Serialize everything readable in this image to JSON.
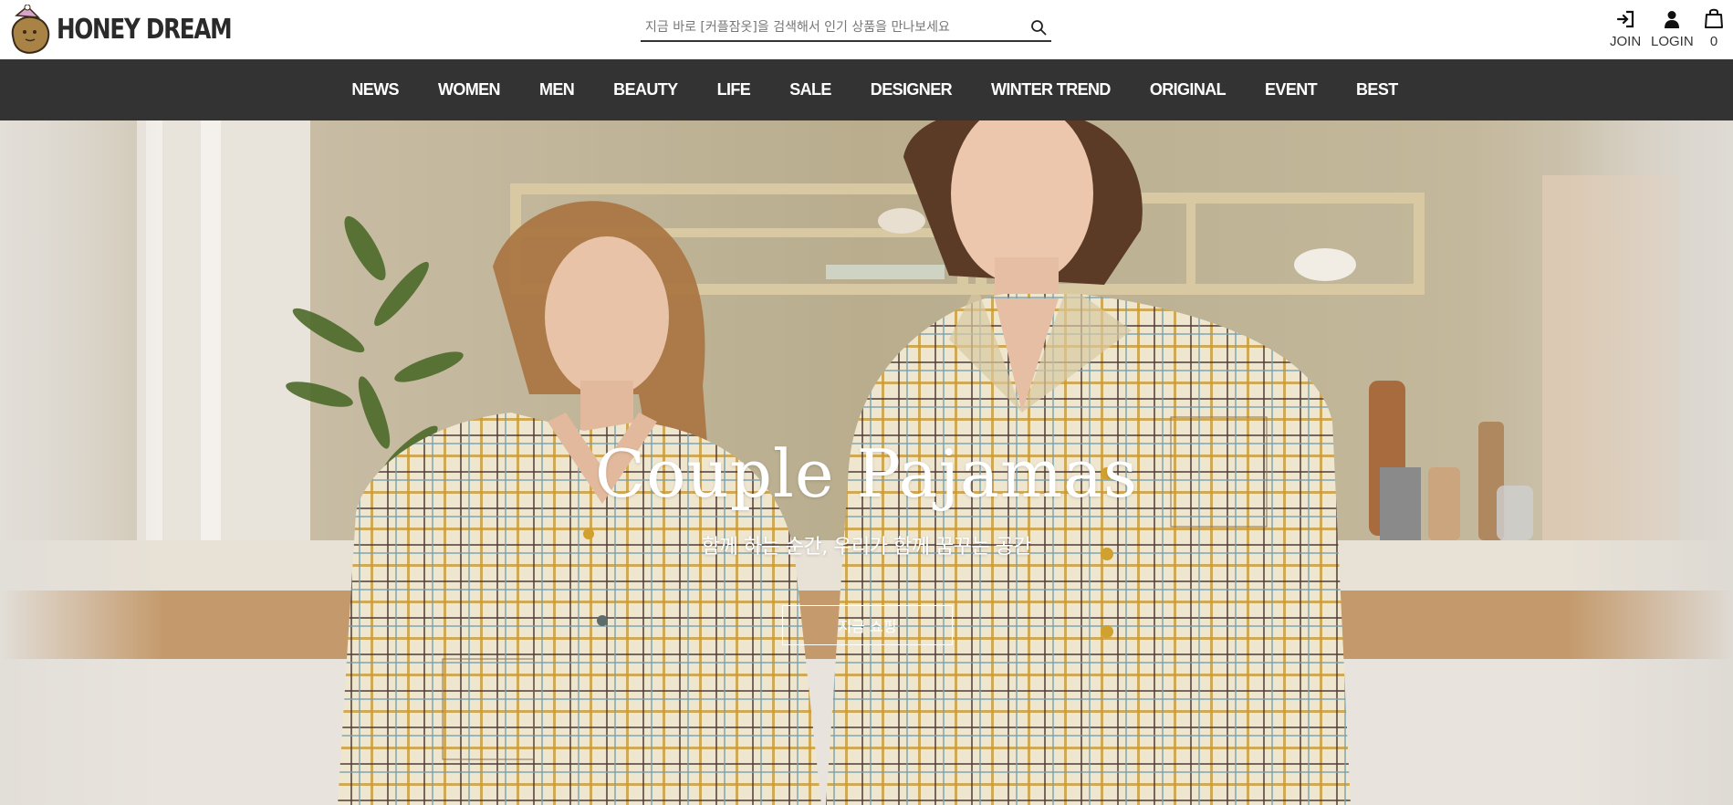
{
  "brand": {
    "name": "HONEY DREAM",
    "logo_icon": "potato-mascot-logo"
  },
  "search": {
    "placeholder": "지금 바로 [커플잠옷]을 검색해서 인기 상품을 만나보세요",
    "value": "",
    "icon": "search-icon"
  },
  "utility": {
    "join_label": "JOIN",
    "login_label": "LOGIN",
    "cart_count": "0",
    "join_icon": "join-arrow-icon",
    "login_icon": "user-icon",
    "cart_icon": "shopping-bag-icon"
  },
  "nav": {
    "items": [
      {
        "label": "NEWS"
      },
      {
        "label": "WOMEN"
      },
      {
        "label": "MEN"
      },
      {
        "label": "BEAUTY"
      },
      {
        "label": "LIFE"
      },
      {
        "label": "SALE"
      },
      {
        "label": "DESIGNER"
      },
      {
        "label": "WINTER TREND"
      },
      {
        "label": "ORIGINAL"
      },
      {
        "label": "EVENT"
      },
      {
        "label": "BEST"
      }
    ]
  },
  "hero": {
    "title": "Couple Pajamas",
    "subtitle": "함께 하는 순간, 우리가 함께 꿈꾸는 공간",
    "cta_label": "지금 쇼핑"
  },
  "colors": {
    "nav_background": "#333333",
    "nav_text": "#ffffff",
    "header_background": "#ffffff",
    "hero_text": "#ffffff"
  }
}
